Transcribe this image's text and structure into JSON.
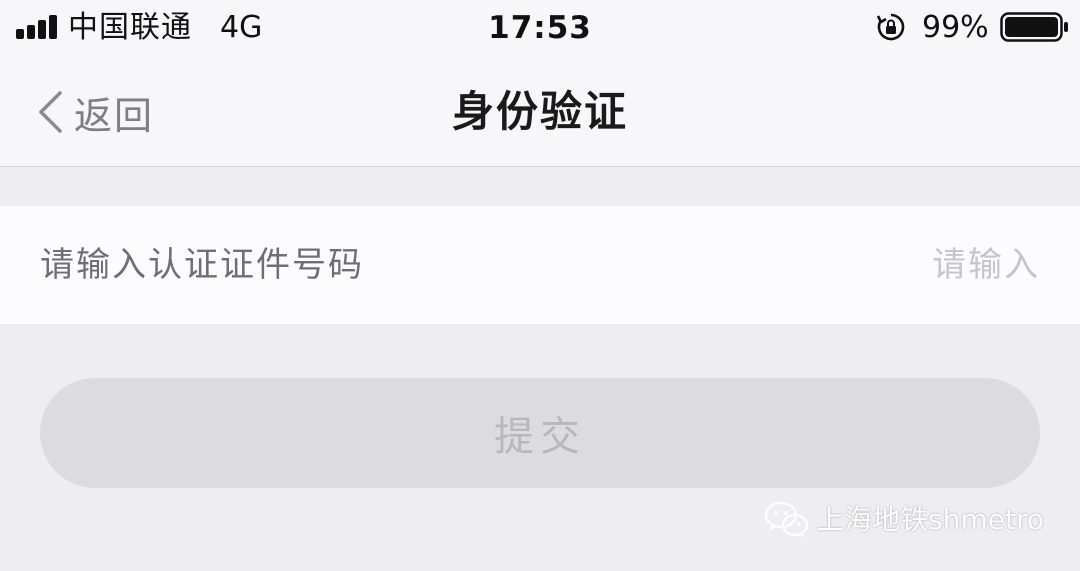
{
  "status_bar": {
    "carrier": "中国联通",
    "network": "4G",
    "time": "17:53",
    "battery_percent": "99%",
    "signal_icon": "signal-bars-icon",
    "rotation_lock_icon": "rotation-lock-icon",
    "battery_icon": "battery-icon"
  },
  "nav": {
    "back_label": "返回",
    "back_icon": "chevron-left-icon",
    "title": "身份验证"
  },
  "form": {
    "id_field_label": "请输入认证证件号码",
    "id_field_placeholder": "请输入",
    "id_field_value": "",
    "submit_label": "提交"
  },
  "watermark": {
    "icon": "wechat-icon",
    "text": "上海地铁shmetro"
  },
  "colors": {
    "background": "#eeedf2",
    "bar_background": "#f7f7f9",
    "button_disabled": "#dcdbe0",
    "button_text_disabled": "#b8b7bc"
  }
}
